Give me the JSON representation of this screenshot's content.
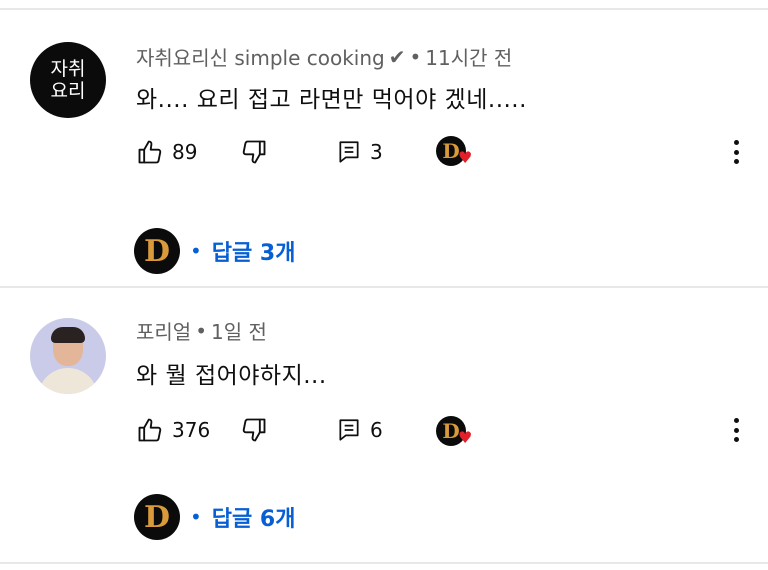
{
  "comments": [
    {
      "avatar_text_line1": "자취",
      "avatar_text_line2": "요리",
      "author": "자취요리신 simple cooking",
      "verified_icon": "checkmark-icon",
      "separator": "•",
      "time": "11시간 전",
      "text": "와.... 요리 접고 라면만 먹어야 겠네.....",
      "likes": "89",
      "replies_count": "3",
      "reply_avatar_letter": "D",
      "reply_dot": "•",
      "reply_label": "답글 3개"
    },
    {
      "author": "포리얼",
      "separator": "•",
      "time": "1일 전",
      "text": "와 뭘 접어야하지...",
      "likes": "376",
      "replies_count": "6",
      "reply_avatar_letter": "D",
      "reply_dot": "•",
      "reply_label": "답글 6개"
    }
  ],
  "creator_badge_letter": "D",
  "heart_glyph": "♥",
  "colors": {
    "link_blue": "#065fd4",
    "heart_red": "#e0202a",
    "meta_gray": "#606060"
  }
}
